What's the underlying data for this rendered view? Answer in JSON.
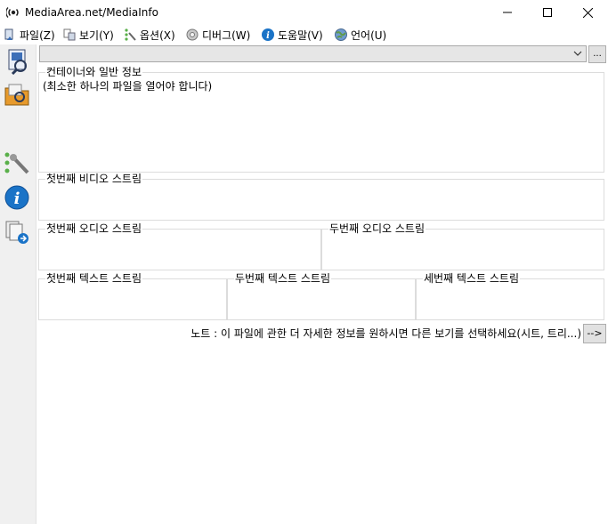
{
  "window": {
    "title": "MediaArea.net/MediaInfo",
    "minimize_icon": "minimize-icon",
    "maximize_icon": "maximize-icon",
    "close_icon": "close-icon"
  },
  "menu": {
    "items": [
      {
        "label": "파일(Z)",
        "icon": "file-icon"
      },
      {
        "label": "보기(Y)",
        "icon": "view-icon"
      },
      {
        "label": "옵션(X)",
        "icon": "options-icon"
      },
      {
        "label": "디버그(W)",
        "icon": "debug-icon"
      },
      {
        "label": "도움말(V)",
        "icon": "help-icon"
      },
      {
        "label": "언어(U)",
        "icon": "language-icon"
      }
    ]
  },
  "sidebar": {
    "buttons": [
      "open-file-icon",
      "open-folder-icon",
      "preferences-icon",
      "about-icon",
      "export-icon"
    ]
  },
  "file_select": {
    "value": "",
    "browse_label": "..."
  },
  "sections": {
    "general": {
      "title": "컨테이너와 일반 정보",
      "text": "(최소한 하나의 파일을 열어야 합니다)"
    },
    "video1": {
      "title": "첫번째 비디오 스트림"
    },
    "audio1": {
      "title": "첫번째 오디오 스트림"
    },
    "audio2": {
      "title": "두번째 오디오 스트림"
    },
    "text1": {
      "title": "첫번째 텍스트 스트림"
    },
    "text2": {
      "title": "두번째 텍스트 스트림"
    },
    "text3": {
      "title": "세번째 텍스트 스트림"
    }
  },
  "note": {
    "text": "노트 : 이 파일에 관한 더 자세한 정보를 원하시면 다른 보기를 선택하세요(시트, 트리...)",
    "button_label": "-->"
  },
  "colors": {
    "accent": "#1a73c7",
    "toolbar_bg": "#f0f0f0",
    "border": "#dcdcdc"
  }
}
